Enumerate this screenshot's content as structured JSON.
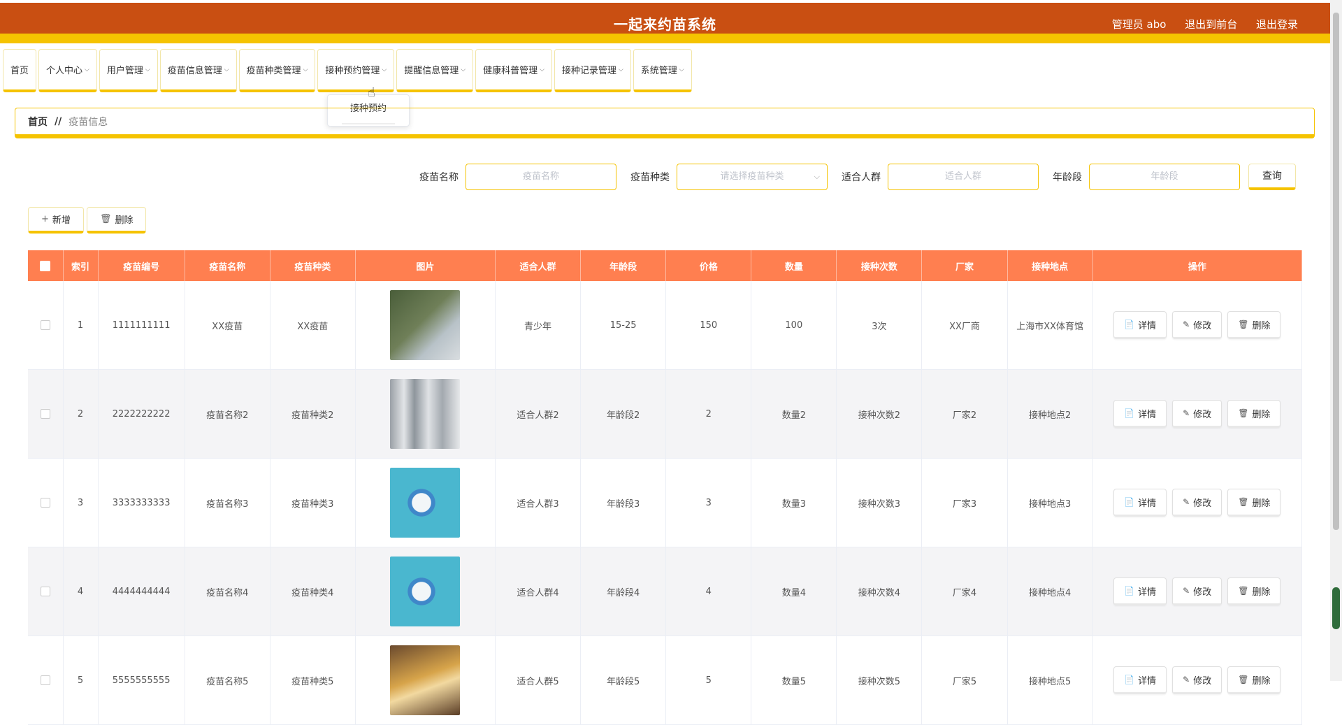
{
  "header": {
    "title": "一起来约苗系统",
    "admin": "管理员 abo",
    "to_front": "退出到前台",
    "logout": "退出登录"
  },
  "nav": {
    "items": [
      {
        "label": "首页",
        "has_menu": false
      },
      {
        "label": "个人中心",
        "has_menu": true
      },
      {
        "label": "用户管理",
        "has_menu": true
      },
      {
        "label": "疫苗信息管理",
        "has_menu": true
      },
      {
        "label": "疫苗种类管理",
        "has_menu": true
      },
      {
        "label": "接种预约管理",
        "has_menu": true
      },
      {
        "label": "提醒信息管理",
        "has_menu": true
      },
      {
        "label": "健康科普管理",
        "has_menu": true
      },
      {
        "label": "接种记录管理",
        "has_menu": true
      },
      {
        "label": "系统管理",
        "has_menu": true
      }
    ],
    "dropdown": [
      "接种预约"
    ]
  },
  "breadcrumb": {
    "home": "首页",
    "sep": "//",
    "current": "疫苗信息"
  },
  "search": {
    "name_label": "疫苗名称",
    "name_placeholder": "疫苗名称",
    "type_label": "疫苗种类",
    "type_placeholder": "请选择疫苗种类",
    "crowd_label": "适合人群",
    "crowd_placeholder": "适合人群",
    "age_label": "年龄段",
    "age_placeholder": "年龄段",
    "query_label": "查询"
  },
  "actions": {
    "add_label": "新增",
    "delete_label": "删除"
  },
  "table": {
    "columns": [
      "索引",
      "疫苗编号",
      "疫苗名称",
      "疫苗种类",
      "图片",
      "适合人群",
      "年龄段",
      "价格",
      "数量",
      "接种次数",
      "厂家",
      "接种地点",
      "操作"
    ],
    "op_labels": {
      "detail": "详情",
      "edit": "修改",
      "delete": "删除"
    },
    "rows": [
      {
        "index": "1",
        "code": "1111111111",
        "name": "XX疫苗",
        "type": "XX疫苗",
        "crowd": "青少年",
        "age": "15-25",
        "price": "150",
        "qty": "100",
        "times": "3次",
        "maker": "XX厂商",
        "place": "上海市XX体育馆",
        "img": "syringe-vial"
      },
      {
        "index": "2",
        "code": "2222222222",
        "name": "疫苗名称2",
        "type": "疫苗种类2",
        "crowd": "适合人群2",
        "age": "年龄段2",
        "price": "2",
        "qty": "数量2",
        "times": "接种次数2",
        "maker": "厂家2",
        "place": "接种地点2",
        "img": "vials-gray"
      },
      {
        "index": "3",
        "code": "3333333333",
        "name": "疫苗名称3",
        "type": "疫苗种类3",
        "crowd": "适合人群3",
        "age": "年龄段3",
        "price": "3",
        "qty": "数量3",
        "times": "接种次数3",
        "maker": "厂家3",
        "place": "接种地点3",
        "img": "vial-blue"
      },
      {
        "index": "4",
        "code": "4444444444",
        "name": "疫苗名称4",
        "type": "疫苗种类4",
        "crowd": "适合人群4",
        "age": "年龄段4",
        "price": "4",
        "qty": "数量4",
        "times": "接种次数4",
        "maker": "厂家4",
        "place": "接种地点4",
        "img": "vial-blue"
      },
      {
        "index": "5",
        "code": "5555555555",
        "name": "疫苗名称5",
        "type": "疫苗种类5",
        "crowd": "适合人群5",
        "age": "年龄段5",
        "price": "5",
        "qty": "数量5",
        "times": "接种次数5",
        "maker": "厂家5",
        "place": "接种地点5",
        "img": "vial-amber"
      }
    ]
  },
  "colors": {
    "header_bg": "#c94f12",
    "accent": "#f5c300",
    "table_head": "#ff7f50"
  }
}
